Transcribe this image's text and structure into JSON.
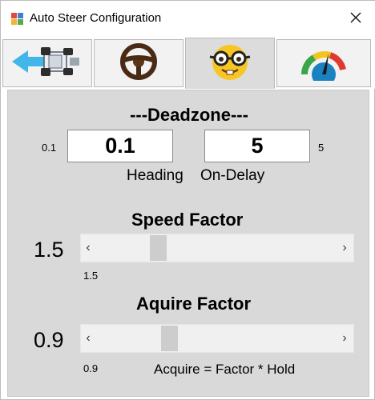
{
  "window": {
    "title": "Auto Steer Configuration",
    "app_icon": "window-app-icon",
    "close_icon": "close-icon"
  },
  "tabs": [
    {
      "icon": "vehicle-arrow-icon",
      "active": false
    },
    {
      "icon": "steering-wheel-icon",
      "active": false
    },
    {
      "icon": "nerd-face-icon",
      "active": true
    },
    {
      "icon": "gauge-icon",
      "active": false
    }
  ],
  "deadzone": {
    "title": "---Deadzone---",
    "heading_value": "0.1",
    "heading_side_value": "0.1",
    "heading_label": "Heading",
    "ondelay_value": "5",
    "ondelay_side_value": "5",
    "ondelay_label": "On-Delay"
  },
  "speed_factor": {
    "title": "Speed Factor",
    "value": "1.5",
    "min_label": "1.5",
    "left_arrow": "‹",
    "right_arrow": "›",
    "position": 0.24
  },
  "acquire_factor": {
    "title": "Aquire Factor",
    "value": "0.9",
    "min_label": "0.9",
    "note": "Acquire = Factor * Hold",
    "left_arrow": "‹",
    "right_arrow": "›",
    "position": 0.29
  },
  "colors": {
    "panel_bg": "#d9d9d9",
    "active_tab_bg": "#dcdcdc",
    "inactive_tab_bg": "#f2f2f2",
    "scroll_track": "#f0f0f0",
    "scroll_thumb": "#cdcdcd"
  }
}
